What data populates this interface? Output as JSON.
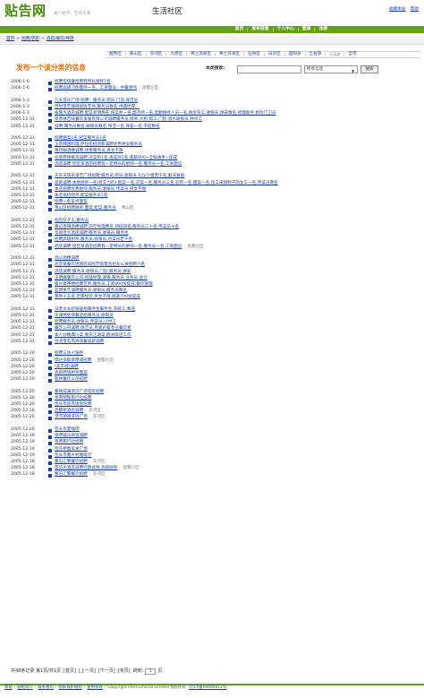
{
  "header": {
    "logo": "贴告网",
    "slogan": "发个帖子，告诉大家",
    "channel": "生活社区",
    "top_links": [
      "收藏本站",
      "帮助"
    ]
  },
  "nav": [
    "首页",
    "发布信息",
    "个人中心",
    "登录",
    "注册"
  ],
  "breadcrumb": [
    "首页",
    "招聘/求职",
    "酒店/餐饮/导游"
  ],
  "districts": [
    {
      "label": "越秀区",
      "small": false
    },
    {
      "label": "黄山区",
      "small": false
    },
    {
      "label": "东河区",
      "small": false
    },
    {
      "label": "九原区",
      "small": false
    },
    {
      "label": "稀土高新区",
      "small": false
    },
    {
      "label": "稀土开发区",
      "small": false
    },
    {
      "label": "石拐区",
      "small": false
    },
    {
      "label": "白云区",
      "small": false
    },
    {
      "label": "固阳县",
      "small": false
    },
    {
      "label": "土右旗",
      "small": false
    },
    {
      "label": "达茂旗",
      "small": true
    },
    {
      "label": "全市",
      "small": false
    }
  ],
  "publish_link": "发布一个该分类的信息",
  "search": {
    "label": "本类搜索:",
    "value": "",
    "select_value": "所有信息",
    "button": "搜索"
  },
  "listings": [
    {
      "date": "2006-1-6",
      "title": "招聘包快餐招聘有特长厨师1名",
      "region": ""
    },
    {
      "date": "2006-1-6",
      "title": "招聘高级刀削面师一名，工资面议，中餐厨师",
      "region": "昆都仑区"
    },
    {
      "date": "2006-1-3",
      "title": "九天音乐广场:招聘：服务员,吧员,门迎,保洁员",
      "region": ""
    },
    {
      "date": "2006-1-3",
      "title": "佳怡宝艺咖啡招收艺师,服务员数名,待遇优厚。",
      "region": ""
    },
    {
      "date": "2006-1-3",
      "title": "泰隆大酒店诚聘:配菜师傅两名,炖菜师一名,面点师一名,后勤维修人员一名,厨房杂工,收银员,保安数名,经理助手,厨房门卫员",
      "region": ""
    },
    {
      "date": "2005-12-31",
      "title": "草原缘吉味餐饮发展有限公司诚聘服务员,厨师,大厨,帮工,门迎,酒水收银员,钟点工",
      "region": ""
    },
    {
      "date": "2005-12-31",
      "title": "诚聘:服务员数名,收银员数名,保洁一名,保安一名,学徒数名",
      "region": ""
    },
    {
      "date": "2005-12-31",
      "title": "招聘面案1名,配菜服务员1名",
      "region": ""
    },
    {
      "date": "2005-12-31",
      "title": "正宗韩国料理,萨拉包招酒家诚聘优秀男女服务员",
      "region": ""
    },
    {
      "date": "2005-12-31",
      "title": "隆热鲜酒楼诚聘:优秀服务员,男女不限",
      "region": ""
    },
    {
      "date": "2005-12-31",
      "title": "任草原德蕉肉诚聘:凉菜师1名,发菜师1名,底薪800+全鲜通奉+提成",
      "region": ""
    },
    {
      "date": "2005-12-31",
      "title": "酒店诚聘:昆区某酒店招聘有一定特长的厨师一名,服务员一名,工资面议",
      "region": ""
    },
    {
      "date": "2005-12-31",
      "title": "天外天快乐演艺广场招聘:服务员,吧员,收银员,礼仪小姐若干名,解决食宿",
      "region": ""
    },
    {
      "date": "2005-12-31",
      "title": "高薪诚聘:本地厨师一名(有实力的),配菜一名,凉菜一名,服务员三名,迎宾一名,面案一名,包工未限制子的女工一名,传菜员两名",
      "region": ""
    },
    {
      "date": "2005-12-31",
      "title": "本店招聘优秀厨师,服务员,收银员,传菜员,男女不限",
      "region": ""
    },
    {
      "date": "2005-12-31",
      "title": "本店低招吧师,配菜服务员1名",
      "region": ""
    },
    {
      "date": "2005-12-31",
      "title": "招聘一名早点面案",
      "region": ""
    },
    {
      "date": "2005-12-31",
      "title": "青山区招聘厨师,面案,配菜,服务员",
      "region": "青山区"
    },
    {
      "date": "2005-12-31",
      "title": "招包饺子工,服务员",
      "region": ""
    },
    {
      "date": "2005-12-31",
      "title": "黄记香辣酒楼诚聘:前厅经理两名,领班四名,服务员二十名,传菜员十名",
      "region": ""
    },
    {
      "date": "2005-12-31",
      "title": "华丽百大酒店诚聘:服务员,收银员,服务生",
      "region": ""
    },
    {
      "date": "2005-12-31",
      "title": "招聘高级厨师,服务员,收银员,点菜员若干名",
      "region": ""
    },
    {
      "date": "2005-12-31",
      "title": "酒店诚聘:昆区某酒店招聘有一定特长的厨师一名,服务员一名,工资面议",
      "region": "昆都仑区"
    },
    {
      "date": "2005-12-31",
      "title": "酒公酒楼诚聘",
      "region": ""
    },
    {
      "date": "2005-12-31",
      "title": "北京某餐饮连锁店诚招节假需急招女公关招聘六名",
      "region": ""
    },
    {
      "date": "2005-12-31",
      "title": "酒店诚聘:服务员,收银员,门迎,服务员,保安",
      "region": ""
    },
    {
      "date": "2005-12-31",
      "title": "玉明峰餐饮公司,招品经理,收银,服务员,业务员,会计",
      "region": ""
    },
    {
      "date": "2005-12-31",
      "title": "嘉兴春茶楼招聘艺师,服务员,工资800加提成,餐饮管理",
      "region": ""
    },
    {
      "date": "2005-12-31",
      "title": "蓝明茶艺诚聘服务员,收银员,服务员数名",
      "region": ""
    },
    {
      "date": "2005-12-31",
      "title": "茶师十五名,无需经验,男女不限,底薪700加提成",
      "region": ""
    },
    {
      "date": "2005-12-31",
      "title": "马老太太砂锅居招服务生服务生,洗碗工,数名",
      "region": ""
    },
    {
      "date": "2005-12-31",
      "title": "东湖烤鱼快餐店招服务员,收银员",
      "region": ""
    },
    {
      "date": "2005-12-31",
      "title": "招聘服务员,收银员,传菜员,小时工",
      "region": ""
    },
    {
      "date": "2005-12-31",
      "title": "餐饮公司诚聘,保洁员,另底价最专业餐饮者",
      "region": ""
    },
    {
      "date": "2005-12-31",
      "title": "本人炒精典川菜,重庆江湖菜,欧洲饭店工作",
      "region": ""
    },
    {
      "date": "2005-12-31",
      "title": "台湾宝岛风尚快餐高薪诚聘",
      "region": ""
    },
    {
      "date": "2005-12-20",
      "title": "招聘三坊火锅师",
      "region": ""
    },
    {
      "date": "2005-12-20",
      "title": "鄂尔多斯草原城招聘",
      "region": "昆都仑区"
    },
    {
      "date": "2005-12-20",
      "title": "(美丰城)诚聘",
      "region": ""
    },
    {
      "date": "2005-12-20",
      "title": "高薪聘请厨师面案",
      "region": ""
    },
    {
      "date": "2005-12-20",
      "title": "乾林餐饮公司招聘",
      "region": ""
    },
    {
      "date": "2005-12-20",
      "title": "繁德成满酒汉广场常年招聘",
      "region": ""
    },
    {
      "date": "2005-12-20",
      "title": "草原明珠旅行社招聘",
      "region": ""
    },
    {
      "date": "2005-12-20",
      "title": "包头市迎宾饭店招聘",
      "region": ""
    },
    {
      "date": "2005-12-20",
      "title": "品都新酒店诚聘",
      "region": "东河区"
    },
    {
      "date": "2005-12-20",
      "title": "漂河德禧洗浴广场",
      "region": "东河区"
    },
    {
      "date": "2005-12-20",
      "title": "包头华夏咖吧",
      "region": ""
    },
    {
      "date": "2005-12-19",
      "title": "草原骏马商贸诚聘",
      "region": ""
    },
    {
      "date": "2005-12-19",
      "title": "草原旅行社招聘",
      "region": ""
    },
    {
      "date": "2005-12-19",
      "title": "恰东桥图美食广场",
      "region": ""
    },
    {
      "date": "2005-12-19",
      "title": "包头市鑫乡村咖啡厅",
      "region": ""
    },
    {
      "date": "2005-12-18",
      "title": "繁石汇繁餐饮招聘",
      "region": "东河区"
    },
    {
      "date": "2005-12-18",
      "title": "亚华大酒店诚聘行政总厨,高级厨师",
      "region": "昆都仑区"
    },
    {
      "date": "2005-12-18",
      "title": "繁石汇繁餐饮招聘",
      "region": "东河区"
    }
  ],
  "pager": {
    "total_text": "共48条记录 第1页/共1页",
    "first": "[首页]",
    "prev": "[上一页]",
    "next": "[下一页]",
    "last": "[末页]",
    "jump": "跳到:",
    "page": "1",
    "unit": "页"
  },
  "footer": {
    "links": [
      "帮助",
      "贴吧简介",
      "联系我们",
      "隐私保护规则",
      "使用条款"
    ],
    "copyright": "Copyright International Limited 版权所有",
    "icp": "京ICP备00000012号"
  }
}
